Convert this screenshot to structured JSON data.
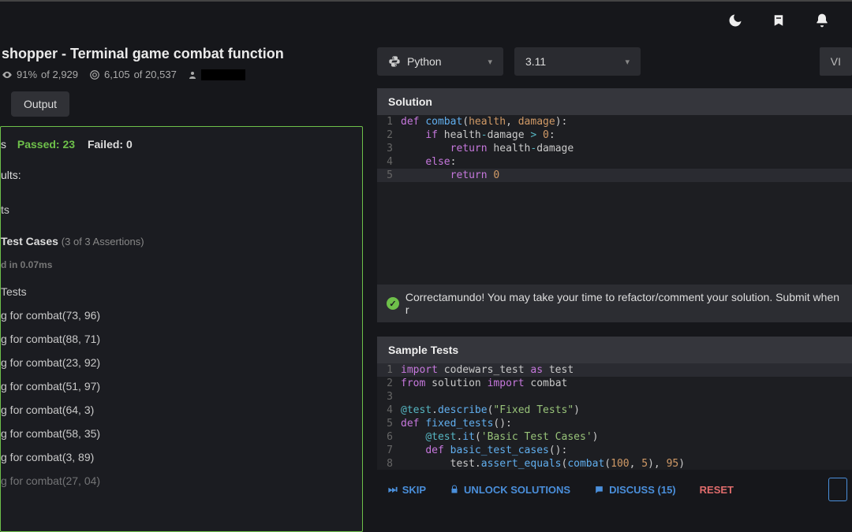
{
  "header": {
    "icons": [
      "moon",
      "bookmark",
      "bell"
    ]
  },
  "kata": {
    "title": "shopper - Terminal game combat function",
    "satisfaction_pct": "91%",
    "satisfaction_of": "of 2,929",
    "completed": "6,105",
    "completed_of": "of 20,537"
  },
  "tabs": {
    "output": "Output"
  },
  "results": {
    "s_prefix": "s",
    "passed_label": "Passed: 23",
    "failed_label": "Failed: 0",
    "heading": "ults:",
    "fixed_tests": "ts",
    "test_cases": "Test Cases",
    "assertions": "(3 of 3 Assertions)",
    "time": "d in 0.07ms",
    "random_tests": "Tests",
    "random": [
      "g for combat(73, 96)",
      "g for combat(88, 71)",
      "g for combat(23, 92)",
      "g for combat(51, 97)",
      "g for combat(64, 3)",
      "g for combat(58, 35)",
      "g for combat(3, 89)",
      "g for combat(27, 04)"
    ]
  },
  "language": {
    "name": "Python",
    "version": "3.11",
    "vi": "VI"
  },
  "solution": {
    "header": "Solution"
  },
  "success": {
    "message": "Correctamundo! You may take your time to refactor/comment your solution. Submit when r"
  },
  "sample": {
    "header": "Sample Tests"
  },
  "actions": {
    "skip": "SKIP",
    "unlock": "UNLOCK SOLUTIONS",
    "discuss": "DISCUSS (15)",
    "reset": "RESET"
  }
}
